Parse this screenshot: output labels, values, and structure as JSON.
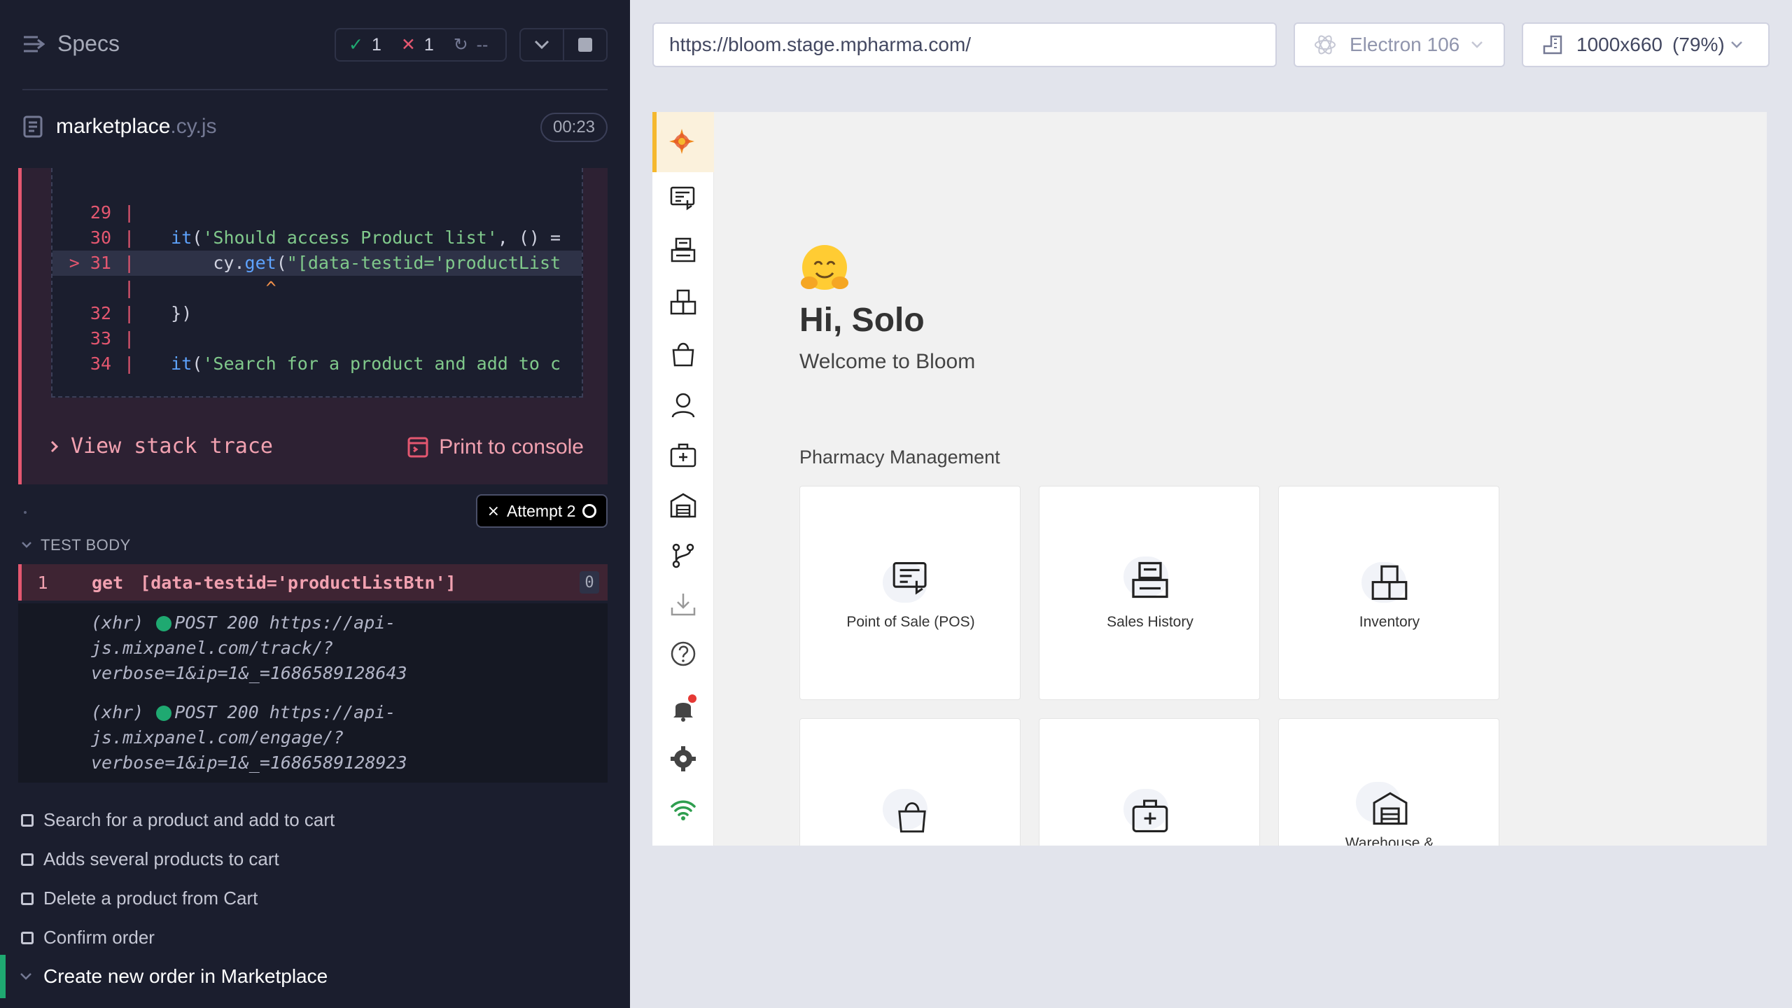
{
  "left": {
    "specs_title": "Specs",
    "stats": {
      "passed": "1",
      "failed": "1",
      "pending": "--"
    },
    "file": {
      "name": "marketplace",
      "ext": ".cy.js",
      "duration": "00:23"
    },
    "code_lines": [
      {
        "num": "29",
        "pipe": "|",
        "code": ""
      },
      {
        "num": "30",
        "pipe": "|",
        "code": "it('Should access Product list', () ="
      },
      {
        "num": "> 31",
        "pipe": "|",
        "code": "cy.get(\"[data-testid='productList"
      },
      {
        "num": "",
        "pipe": "|",
        "code": "^"
      },
      {
        "num": "32",
        "pipe": "|",
        "code": "})"
      },
      {
        "num": "33",
        "pipe": "|",
        "code": ""
      },
      {
        "num": "34",
        "pipe": "|",
        "code": "it('Search for a product and add to c"
      }
    ],
    "view_stack_trace": "View stack trace",
    "print_to_console": "Print to console",
    "attempt": "Attempt 2",
    "test_body_label": "TEST BODY",
    "command": {
      "num": "1",
      "name": "get",
      "selector": "[data-testid='productListBtn']",
      "count": "0"
    },
    "xhr": [
      {
        "prefix": "(xhr)",
        "method": "POST 200 https://api-",
        "l2": "js.mixpanel.com/track/?",
        "l3": "verbose=1&ip=1&_=1686589128643"
      },
      {
        "prefix": "(xhr)",
        "method": "POST 200 https://api-",
        "l2": "js.mixpanel.com/engage/?",
        "l3": "verbose=1&ip=1&_=1686589128923"
      }
    ],
    "tests": [
      "Search for a product and add to cart",
      "Adds several products to cart",
      "Delete a product from Cart",
      "Confirm order"
    ],
    "suite": "Create new order in Marketplace"
  },
  "right": {
    "url": "https://bloom.stage.mpharma.com/",
    "browser": "Electron 106",
    "viewport": "1000x660",
    "zoom": "(79%)",
    "app": {
      "greeting": "Hi, Solo",
      "welcome": "Welcome to Bloom",
      "section": "Pharmacy Management",
      "cards": [
        "Point of Sale (POS)",
        "Sales History",
        "Inventory",
        "",
        "",
        "Warehouse &"
      ],
      "sidebar_icons": [
        "bloom-logo-icon",
        "pos-icon",
        "sales-history-icon",
        "inventory-icon",
        "shopping-bag-icon",
        "customer-icon",
        "medical-kit-icon",
        "warehouse-icon",
        "git-branch-icon",
        "download-tray-icon",
        "help-icon",
        "bell-icon",
        "gear-icon",
        "wifi-icon"
      ]
    }
  }
}
